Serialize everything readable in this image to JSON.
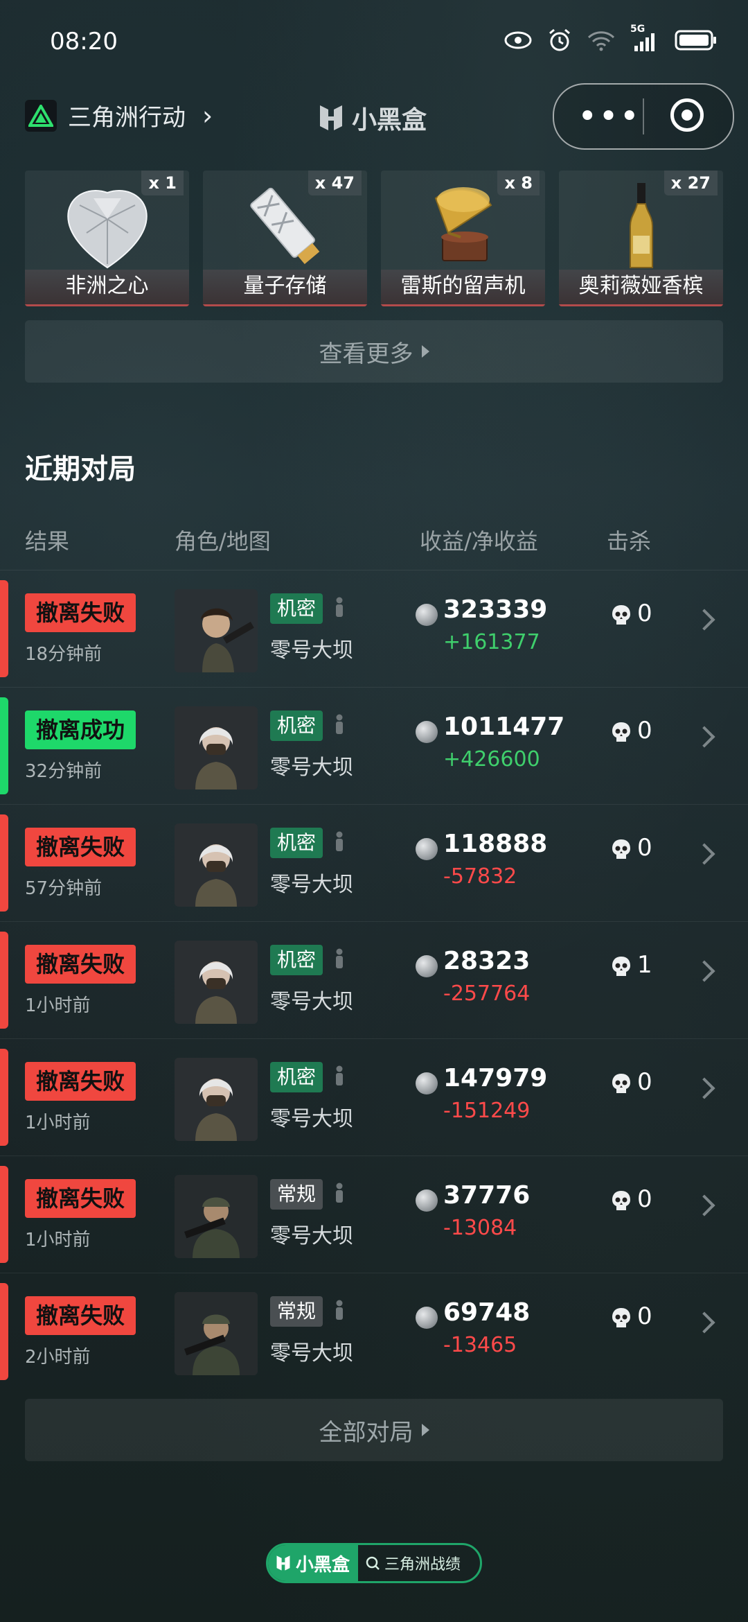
{
  "status_bar": {
    "time": "08:20",
    "network": "5G"
  },
  "header": {
    "app_name": "三角洲行动",
    "brand": "小黑盒"
  },
  "items": [
    {
      "name": "非洲之心",
      "count": "x 1"
    },
    {
      "name": "量子存储",
      "count": "x 47"
    },
    {
      "name": "雷斯的留声机",
      "count": "x 8"
    },
    {
      "name": "奥莉薇娅香槟",
      "count": "x 27"
    }
  ],
  "more_label": "查看更多",
  "section_title": "近期对局",
  "columns": {
    "result": "结果",
    "role_map": "角色/地图",
    "income": "收益/净收益",
    "kills": "击杀"
  },
  "matches": [
    {
      "result": "撤离失败",
      "status": "fail",
      "ago": "18分钟前",
      "mode": "机密",
      "map": "零号大坝",
      "income": "323339",
      "net": "+161377",
      "kills": "0",
      "avatar": "female-gunner"
    },
    {
      "result": "撤离成功",
      "status": "success",
      "ago": "32分钟前",
      "mode": "机密",
      "map": "零号大坝",
      "income": "1011477",
      "net": "+426600",
      "kills": "0",
      "avatar": "white-hair"
    },
    {
      "result": "撤离失败",
      "status": "fail",
      "ago": "57分钟前",
      "mode": "机密",
      "map": "零号大坝",
      "income": "118888",
      "net": "-57832",
      "kills": "0",
      "avatar": "white-hair"
    },
    {
      "result": "撤离失败",
      "status": "fail",
      "ago": "1小时前",
      "mode": "机密",
      "map": "零号大坝",
      "income": "28323",
      "net": "-257764",
      "kills": "1",
      "avatar": "white-hair"
    },
    {
      "result": "撤离失败",
      "status": "fail",
      "ago": "1小时前",
      "mode": "机密",
      "map": "零号大坝",
      "income": "147979",
      "net": "-151249",
      "kills": "0",
      "avatar": "white-hair"
    },
    {
      "result": "撤离失败",
      "status": "fail",
      "ago": "1小时前",
      "mode": "常规",
      "map": "零号大坝",
      "income": "37776",
      "net": "-13084",
      "kills": "0",
      "avatar": "soldier"
    },
    {
      "result": "撤离失败",
      "status": "fail",
      "ago": "2小时前",
      "mode": "常规",
      "map": "零号大坝",
      "income": "69748",
      "net": "-13465",
      "kills": "0",
      "avatar": "soldier"
    }
  ],
  "all_label": "全部对局",
  "footer": {
    "brand": "小黑盒",
    "tag": "三角洲战绩"
  },
  "colors": {
    "fail": "#f0473f",
    "success": "#1ed86a",
    "net_positive": "#3fcf6c",
    "net_negative": "#ff4a4a",
    "mode_secret": "#1f7a52",
    "mode_normal": "#4a4f52"
  }
}
